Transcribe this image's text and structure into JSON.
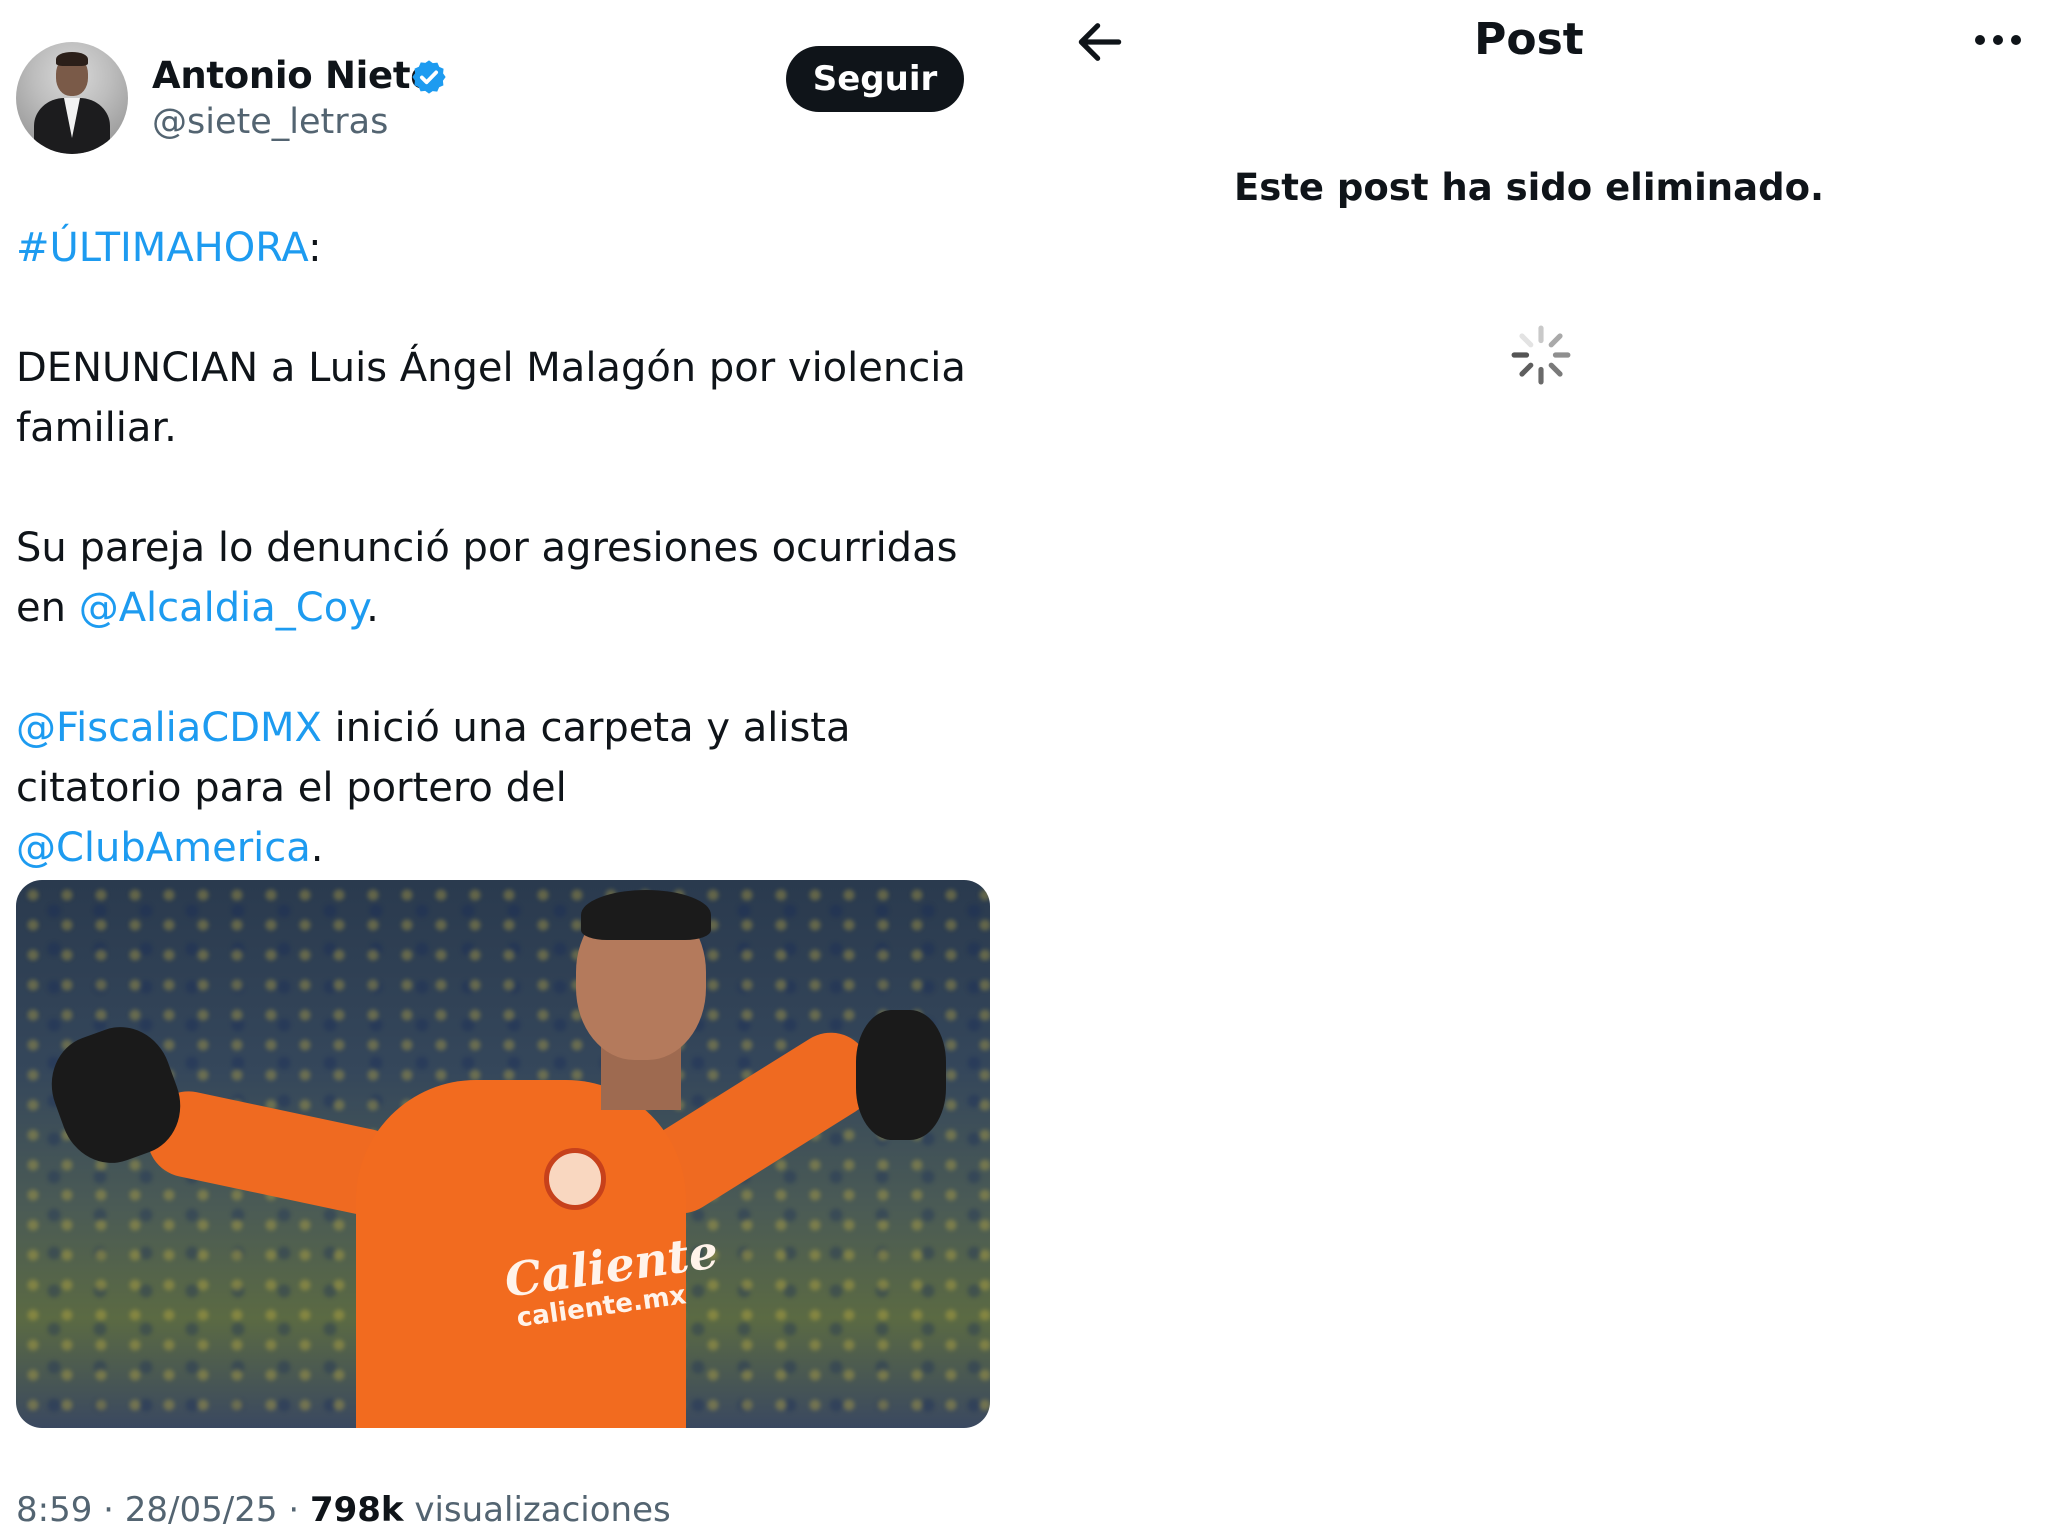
{
  "tweet": {
    "author_name": "Antonio Nieto",
    "author_handle": "@siete_letras",
    "follow_label": "Seguir",
    "hashtag": "#ÚLTIMAHORA",
    "hashtag_suffix": ":",
    "line1": "DENUNCIAN a Luis Ángel Malagón por violencia familiar.",
    "line2_text": "Su pareja lo denunció por agresiones ocurridas en ",
    "line2_mention": "@Alcaldia_Coy",
    "line2_end": ".",
    "line3_mention": "@FiscaliaCDMX",
    "line3_text": " inició una carpeta y alista citatorio para el portero del ",
    "line3_mention2": "@ClubAmerica",
    "line3_end": ".",
    "media": {
      "sponsor_logo": "Caliente",
      "sponsor_url": "caliente.mx"
    },
    "time": "8:59",
    "date": "28/05/25",
    "views_count": "798k",
    "views_label": "visualizaciones",
    "separator": "·",
    "icons": {
      "verified": "verified-badge-icon"
    }
  },
  "post_view": {
    "title": "Post",
    "deleted_message": "Este post ha sido eliminado.",
    "icons": {
      "back": "back-arrow-icon",
      "more": "more-icon",
      "loading": "loading-spinner-icon"
    }
  },
  "colors": {
    "link": "#1d9bf0",
    "text": "#0f1419",
    "secondary": "#536471",
    "button_bg": "#0f1419"
  }
}
